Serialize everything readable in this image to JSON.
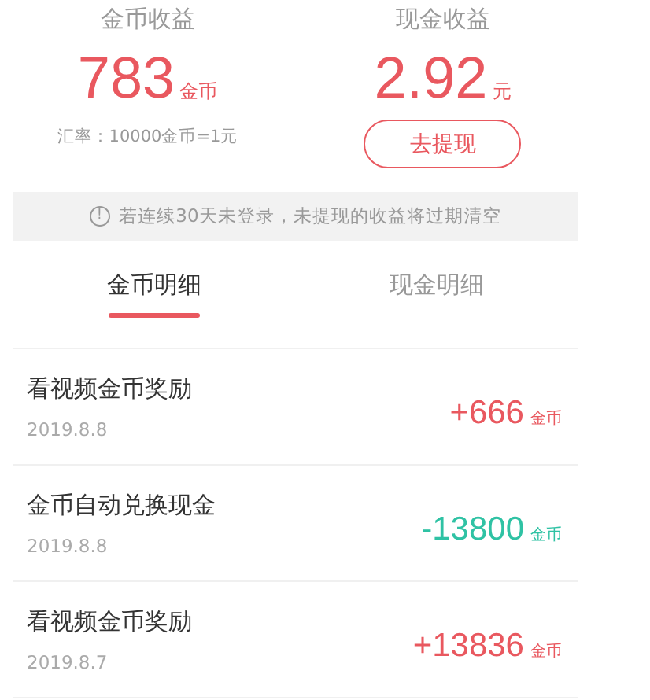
{
  "summary": [
    {
      "title": "金币收益",
      "value": "783",
      "unit": "金币",
      "note": "汇率：10000金币=1元"
    },
    {
      "title": "现金收益",
      "value": "2.92",
      "unit": "元",
      "button": "去提现"
    }
  ],
  "notice": {
    "icon": "!",
    "text": "若连续30天未登录，未提现的收益将过期清空"
  },
  "tabs": [
    {
      "label": "金币明细",
      "selected": true
    },
    {
      "label": "现金明细",
      "selected": false
    }
  ],
  "records": [
    {
      "title": "看视频金币奖励",
      "date": "2019.8.8",
      "amount": "+666",
      "unit": "金币",
      "kind": "income"
    },
    {
      "title": "金币自动兑换现金",
      "date": "2019.8.8",
      "amount": "-13800",
      "unit": "金币",
      "kind": "expense"
    },
    {
      "title": "看视频金币奖励",
      "date": "2019.8.7",
      "amount": "+13836",
      "unit": "金币",
      "kind": "income"
    }
  ]
}
